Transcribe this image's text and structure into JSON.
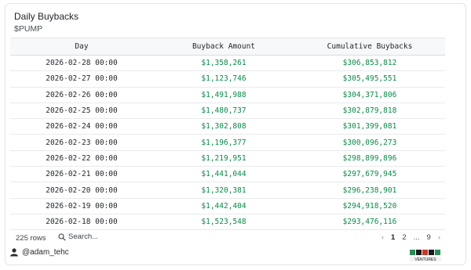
{
  "header": {
    "title": "Daily Buybacks",
    "subtitle": "$PUMP"
  },
  "table": {
    "columns": [
      "Day",
      "Buyback Amount",
      "Cumulative Buybacks"
    ],
    "rows": [
      {
        "day": "2026-02-28 00:00",
        "amount": "$1,358,261",
        "cumulative": "$306,853,812"
      },
      {
        "day": "2026-02-27 00:00",
        "amount": "$1,123,746",
        "cumulative": "$305,495,551"
      },
      {
        "day": "2026-02-26 00:00",
        "amount": "$1,491,988",
        "cumulative": "$304,371,806"
      },
      {
        "day": "2026-02-25 00:00",
        "amount": "$1,480,737",
        "cumulative": "$302,879,818"
      },
      {
        "day": "2026-02-24 00:00",
        "amount": "$1,302,808",
        "cumulative": "$301,399,081"
      },
      {
        "day": "2026-02-23 00:00",
        "amount": "$1,196,377",
        "cumulative": "$300,096,273"
      },
      {
        "day": "2026-02-22 00:00",
        "amount": "$1,219,951",
        "cumulative": "$298,899,896"
      },
      {
        "day": "2026-02-21 00:00",
        "amount": "$1,441,044",
        "cumulative": "$297,679,945"
      },
      {
        "day": "2026-02-20 00:00",
        "amount": "$1,320,381",
        "cumulative": "$296,238,901"
      },
      {
        "day": "2026-02-19 00:00",
        "amount": "$1,442,404",
        "cumulative": "$294,918,520"
      },
      {
        "day": "2026-02-18 00:00",
        "amount": "$1,523,548",
        "cumulative": "$293,476,116"
      }
    ]
  },
  "footer": {
    "rows_count": "225 rows",
    "search_placeholder": "Search...",
    "pager": {
      "prev": "‹",
      "page1": "1",
      "page2": "2",
      "ellipsis": "...",
      "last": "9",
      "next": "›"
    }
  },
  "author": {
    "handle": "@adam_tehc",
    "icon": "user-avatar-icon"
  },
  "logo": {
    "icon": "venture-logo",
    "text": "VENTURES"
  },
  "colors": {
    "positive_number": "#0a8a4a",
    "header_bg": "#f7f8f9",
    "border": "#e3e5e8"
  }
}
